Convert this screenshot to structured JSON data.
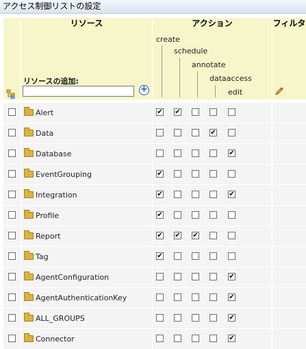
{
  "title": "アクセス制御リストの設定",
  "headers": {
    "resource": "リソース",
    "action": "アクション",
    "filter": "フィルタ"
  },
  "actions": [
    "create",
    "schedule",
    "annotate",
    "dataaccess",
    "edit"
  ],
  "add_resource": {
    "label": "リソースの追加:",
    "value": ""
  },
  "icons": {
    "tree": "tree-icon",
    "add": "add-icon",
    "edit": "pencil-icon",
    "folder": "folder-icon",
    "delete": "trash-icon"
  },
  "rows": [
    {
      "name": "Alert",
      "perms": [
        true,
        true,
        false,
        false,
        false
      ]
    },
    {
      "name": "Data",
      "perms": [
        false,
        false,
        false,
        true,
        false
      ]
    },
    {
      "name": "Database",
      "perms": [
        false,
        false,
        false,
        false,
        true
      ]
    },
    {
      "name": "EventGrouping",
      "perms": [
        true,
        false,
        false,
        false,
        false
      ]
    },
    {
      "name": "Integration",
      "perms": [
        true,
        false,
        false,
        false,
        true
      ]
    },
    {
      "name": "Profile",
      "perms": [
        true,
        false,
        false,
        false,
        false
      ]
    },
    {
      "name": "Report",
      "perms": [
        true,
        true,
        true,
        false,
        false
      ]
    },
    {
      "name": "Tag",
      "perms": [
        true,
        false,
        false,
        false,
        false
      ]
    },
    {
      "name": "AgentConfiguration",
      "perms": [
        false,
        false,
        false,
        false,
        true
      ]
    },
    {
      "name": "AgentAuthenticationKey",
      "perms": [
        false,
        false,
        false,
        false,
        true
      ]
    },
    {
      "name": "ALL_GROUPS",
      "perms": [
        false,
        false,
        false,
        false,
        true
      ]
    },
    {
      "name": "Connector",
      "perms": [
        false,
        false,
        false,
        false,
        true
      ]
    }
  ]
}
